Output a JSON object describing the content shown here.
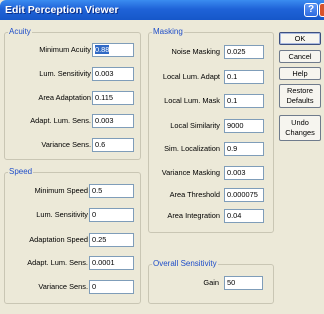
{
  "window": {
    "title": "Edit Perception Viewer",
    "help_glyph": "?"
  },
  "acuity": {
    "title": "Acuity",
    "fields": [
      {
        "label": "Minimum Acuity",
        "value": "0.88"
      },
      {
        "label": "Lum. Sensitivity",
        "value": "0.003"
      },
      {
        "label": "Area Adaptation",
        "value": "0.115"
      },
      {
        "label": "Adapt. Lum. Sens.",
        "value": "0.003"
      },
      {
        "label": "Variance Sens.",
        "value": "0.6"
      }
    ]
  },
  "speed": {
    "title": "Speed",
    "fields": [
      {
        "label": "Minimum Speed",
        "value": "0.5"
      },
      {
        "label": "Lum. Sensitivity",
        "value": "0"
      },
      {
        "label": "Adaptation Speed",
        "value": "0.25"
      },
      {
        "label": "Adapt. Lum. Sens.",
        "value": "0.0001"
      },
      {
        "label": "Variance Sens.",
        "value": "0"
      }
    ]
  },
  "masking": {
    "title": "Masking",
    "fields": [
      {
        "label": "Noise Masking",
        "value": "0.025"
      },
      {
        "label": "Local Lum. Adapt",
        "value": "0.1"
      },
      {
        "label": "Local Lum. Mask",
        "value": "0.1"
      },
      {
        "label": "Local Similarity",
        "value": "9000"
      },
      {
        "label": "Sim. Localization",
        "value": "0.9"
      },
      {
        "label": "Variance Masking",
        "value": "0.003"
      },
      {
        "label": "Area Threshold",
        "value": "0.000075"
      },
      {
        "label": "Area Integration",
        "value": "0.04"
      }
    ]
  },
  "overall": {
    "title": "Overall Sensitivity",
    "gain": {
      "label": "Gain",
      "value": "50"
    }
  },
  "buttons": {
    "ok": "OK",
    "cancel": "Cancel",
    "help": "Help",
    "restore_line1": "Restore",
    "restore_line2": "Defaults",
    "undo_line1": "Undo",
    "undo_line2": "Changes"
  },
  "colors": {
    "titlebar": "#1f63d8",
    "group_title": "#1f4ec9",
    "selection": "#316ac5",
    "dialog_bg": "#ece9d8"
  }
}
